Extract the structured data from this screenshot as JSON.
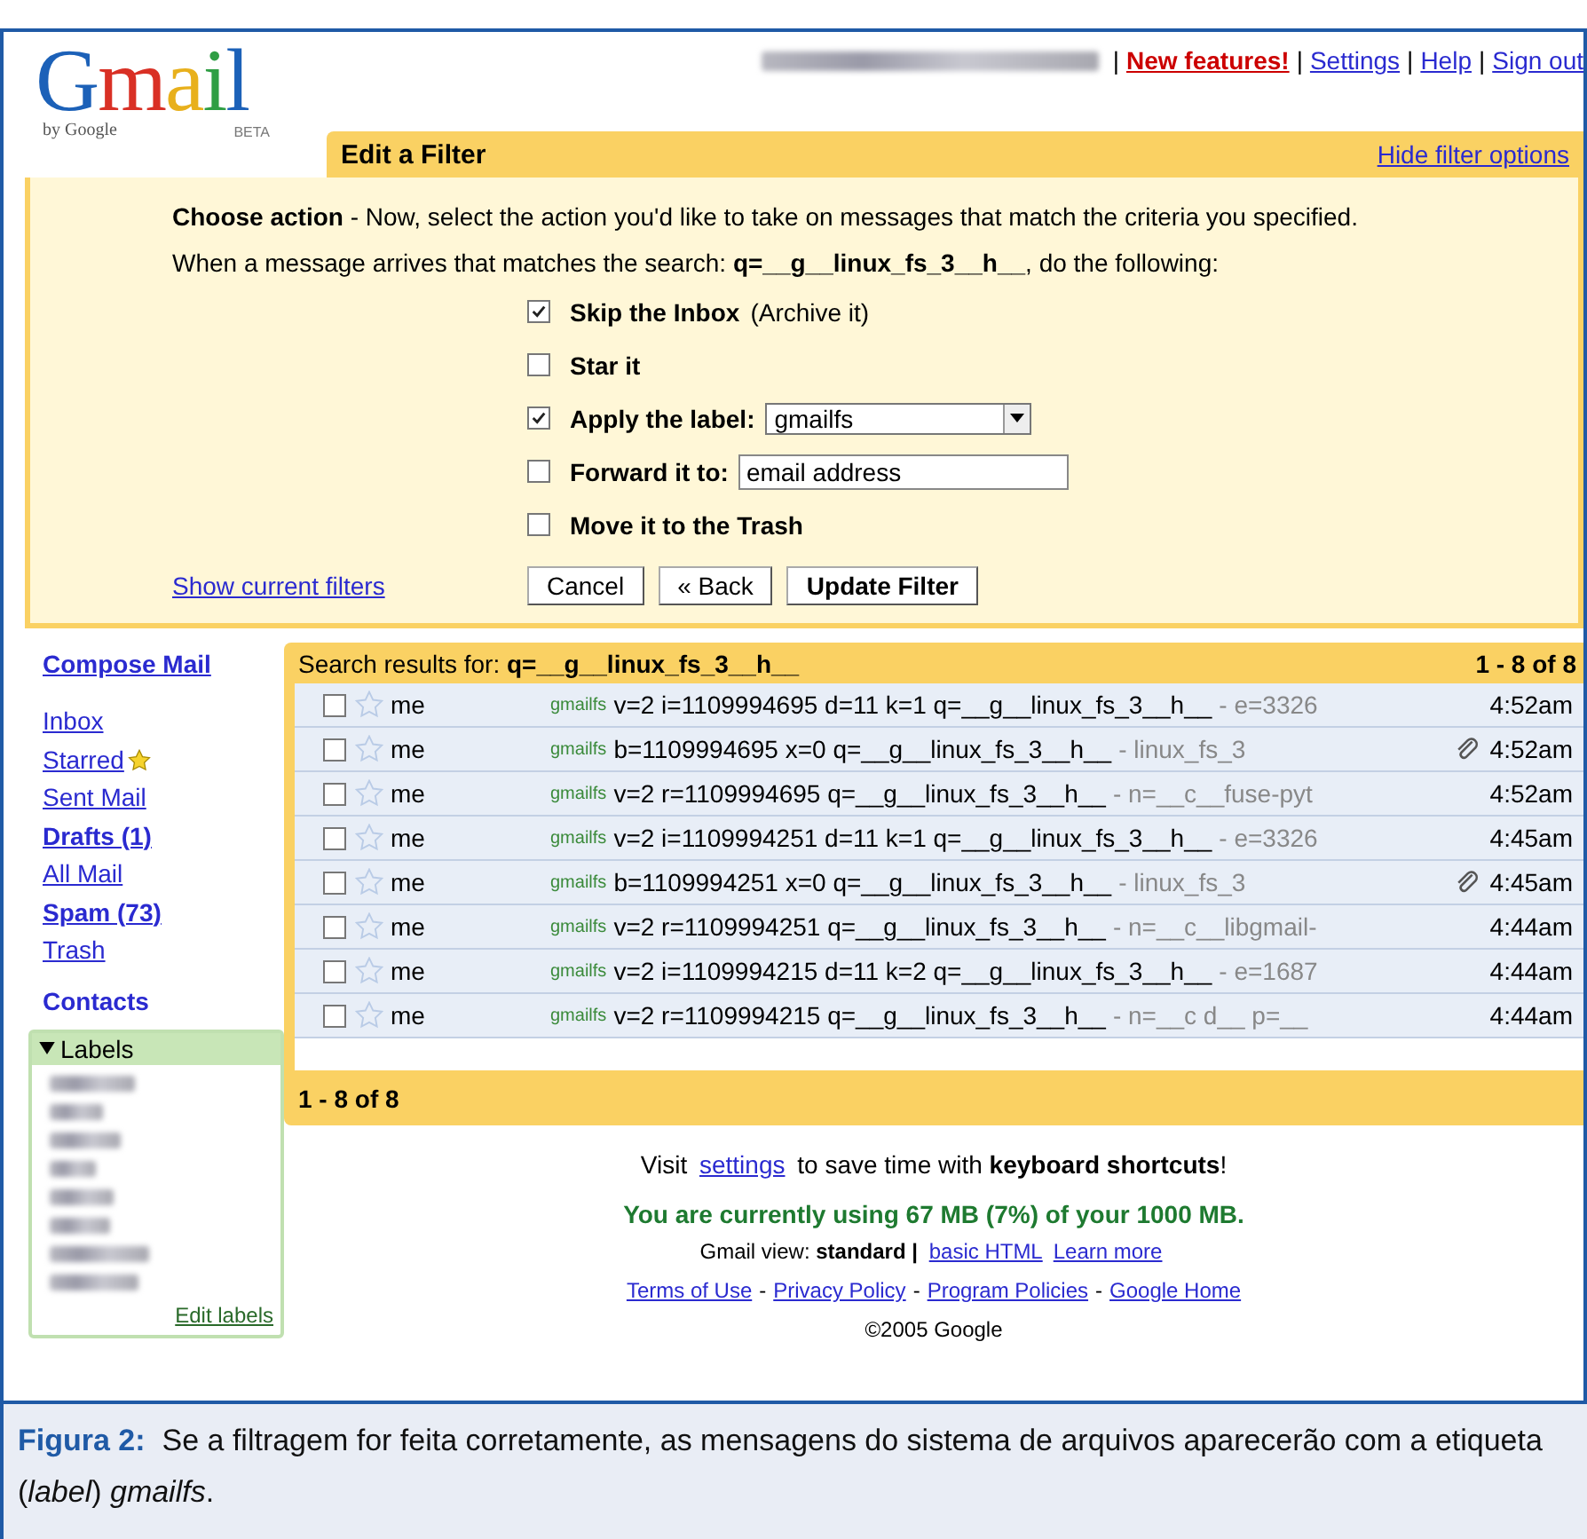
{
  "header": {
    "separator": "|",
    "logo": {
      "text": "Gmail",
      "byline": "by Google",
      "badge": "BETA"
    },
    "account": {
      "kind": "blurred"
    },
    "links": [
      {
        "label": "New features!",
        "kind": "highlight"
      },
      {
        "label": "Settings",
        "kind": "plain"
      },
      {
        "label": "Help",
        "kind": "plain"
      },
      {
        "label": "Sign out",
        "kind": "plain"
      }
    ]
  },
  "filter": {
    "title": "Edit a Filter",
    "hide_link": "Hide filter options",
    "intro": "**Choose action** - Now, select the action you'd like to take on messages that match the criteria you specified.",
    "search_line": "When a message arrives that matches the search: **q=__g__linux_fs_3__h__**, do the following:",
    "actions": [
      {
        "kind": "plain",
        "label": "Skip the Inbox",
        "note": "(Archive it)",
        "checked": true
      },
      {
        "kind": "plain",
        "label": "Star it",
        "checked": false
      },
      {
        "kind": "select",
        "label": "Apply the label:",
        "value": "gmailfs",
        "checked": true
      },
      {
        "kind": "input",
        "label": "Forward it to:",
        "value": "email address",
        "checked": false
      },
      {
        "kind": "plain",
        "label": "Move it to the Trash",
        "checked": false
      }
    ],
    "show_filters": "Show current filters",
    "buttons": [
      {
        "label": "Cancel",
        "primary": false
      },
      {
        "label": "« Back",
        "primary": false
      },
      {
        "label": "Update Filter",
        "primary": true
      }
    ]
  },
  "sidebar": {
    "compose": "Compose Mail",
    "items": [
      {
        "label": "Inbox",
        "bold": false,
        "starred": false
      },
      {
        "label": "Starred",
        "bold": false,
        "starred": true
      },
      {
        "label": "Sent Mail",
        "bold": false,
        "starred": false
      },
      {
        "label": "Drafts (1)",
        "bold": true,
        "starred": false
      },
      {
        "label": "All Mail",
        "bold": false,
        "starred": false
      },
      {
        "label": "Spam (73)",
        "bold": true,
        "starred": false
      },
      {
        "label": "Trash",
        "bold": false,
        "starred": false
      }
    ],
    "contacts": "Contacts",
    "labels": {
      "title": "Labels",
      "expanded": true,
      "items": [
        {
          "kind": "blurred"
        },
        {
          "kind": "blurred"
        },
        {
          "kind": "blurred"
        },
        {
          "kind": "blurred"
        },
        {
          "kind": "blurred"
        },
        {
          "kind": "blurred"
        },
        {
          "kind": "blurred"
        },
        {
          "kind": "blurred"
        }
      ],
      "edit": "Edit labels"
    }
  },
  "results": {
    "heading": "Search results for:",
    "query": "q=__g__linux_fs_3__h__",
    "count": "1 - 8 of 8",
    "footer_count": "1 - 8 of 8",
    "rows": [
      {
        "sender": "me",
        "label": "gmailfs",
        "subject": "v=2 i=1109994695 d=11 k=1 q=__g__linux_fs_3__h__",
        "snippet": "- e=3326",
        "attachment": false,
        "time": "4:52am",
        "checked": false,
        "starred": false
      },
      {
        "sender": "me",
        "label": "gmailfs",
        "subject": "b=1109994695 x=0 q=__g__linux_fs_3__h__",
        "snippet": "- linux_fs_3",
        "attachment": true,
        "time": "4:52am",
        "checked": false,
        "starred": false
      },
      {
        "sender": "me",
        "label": "gmailfs",
        "subject": "v=2 r=1109994695 q=__g__linux_fs_3__h__",
        "snippet": "- n=__c__fuse-pyt",
        "attachment": false,
        "time": "4:52am",
        "checked": false,
        "starred": false
      },
      {
        "sender": "me",
        "label": "gmailfs",
        "subject": "v=2 i=1109994251 d=11 k=1 q=__g__linux_fs_3__h__",
        "snippet": "- e=3326",
        "attachment": false,
        "time": "4:45am",
        "checked": false,
        "starred": false
      },
      {
        "sender": "me",
        "label": "gmailfs",
        "subject": "b=1109994251 x=0 q=__g__linux_fs_3__h__",
        "snippet": "- linux_fs_3",
        "attachment": true,
        "time": "4:45am",
        "checked": false,
        "starred": false
      },
      {
        "sender": "me",
        "label": "gmailfs",
        "subject": "v=2 r=1109994251 q=__g__linux_fs_3__h__",
        "snippet": "- n=__c__libgmail-",
        "attachment": false,
        "time": "4:44am",
        "checked": false,
        "starred": false
      },
      {
        "sender": "me",
        "label": "gmailfs",
        "subject": "v=2 i=1109994215 d=11 k=2 q=__g__linux_fs_3__h__",
        "snippet": "- e=1687",
        "attachment": false,
        "time": "4:44am",
        "checked": false,
        "starred": false
      },
      {
        "sender": "me",
        "label": "gmailfs",
        "subject": "v=2 r=1109994215 q=__g__linux_fs_3__h__",
        "snippet": "- n=__c d__ p=__",
        "attachment": false,
        "time": "4:44am",
        "checked": false,
        "starred": false
      }
    ]
  },
  "footer": {
    "shortcuts": {
      "before": "Visit",
      "link": "settings",
      "after": "to save time with **keyboard shortcuts**!"
    },
    "usage": "You are currently using 67 MB (7%) of your 1000 MB.",
    "view": {
      "label": "Gmail view:",
      "current": "standard",
      "separator": "|",
      "links": [
        "basic HTML",
        "Learn more"
      ]
    },
    "link_separator": "-",
    "links": [
      "Terms of Use",
      "Privacy Policy",
      "Program Policies",
      "Google Home"
    ],
    "copyright": "©2005 Google"
  },
  "caption": {
    "label": "Figura 2:",
    "text": "Se a filtragem for feita corretamente, as mensagens do sistema de arquivos aparecerão com a etiqueta (*label*) *gmailfs*."
  }
}
